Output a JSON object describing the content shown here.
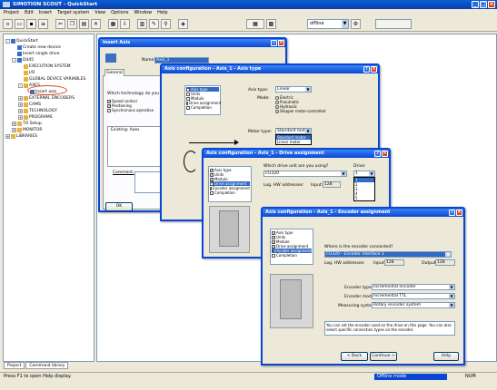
{
  "app": {
    "title": "SIMOTION SCOUT - QuickStart"
  },
  "menu": [
    "Project",
    "Edit",
    "Insert",
    "Target system",
    "View",
    "Options",
    "Window",
    "Help"
  ],
  "toolbar": {
    "mode_select": "offline",
    "mode_arrow": "▼"
  },
  "tree": {
    "items": [
      {
        "label": "QuickStart",
        "indent": 0,
        "expander": "-",
        "icon": "project"
      },
      {
        "label": "Create new device",
        "indent": 1,
        "expander": "",
        "icon": "device"
      },
      {
        "label": "Insert single drive",
        "indent": 1,
        "expander": "",
        "icon": "device"
      },
      {
        "label": "D445",
        "indent": 1,
        "expander": "-",
        "icon": "device"
      },
      {
        "label": "EXECUTION SYSTEM",
        "indent": 2,
        "expander": "",
        "icon": "folder"
      },
      {
        "label": "I/O",
        "indent": 2,
        "expander": "",
        "icon": "folder"
      },
      {
        "label": "GLOBAL DEVICE VARIABLES",
        "indent": 2,
        "expander": "",
        "icon": "folder"
      },
      {
        "label": "AXES",
        "indent": 2,
        "expander": "-",
        "icon": "folder"
      },
      {
        "label": "Insert axis",
        "indent": 3,
        "expander": "",
        "icon": "axis"
      },
      {
        "label": "EXTERNAL ENCODERS",
        "indent": 2,
        "expander": "+",
        "icon": "folder"
      },
      {
        "label": "CAMS",
        "indent": 2,
        "expander": "+",
        "icon": "folder"
      },
      {
        "label": "TECHNOLOGY",
        "indent": 2,
        "expander": "+",
        "icon": "folder"
      },
      {
        "label": "PROGRAMS",
        "indent": 2,
        "expander": "+",
        "icon": "folder"
      },
      {
        "label": "TO Setup",
        "indent": 1,
        "expander": "+",
        "icon": "folder"
      },
      {
        "label": "MONITOR",
        "indent": 1,
        "expander": "+",
        "icon": "folder"
      },
      {
        "label": "LIBRARIES",
        "indent": 0,
        "expander": "+",
        "icon": "folder"
      }
    ]
  },
  "tabs": [
    "Project",
    "Command library"
  ],
  "status": {
    "help": "Press F1 to open Help display.",
    "mode": "Offline mode",
    "num": "NUM"
  },
  "insert_axis": {
    "title": "Insert Axis",
    "name_label": "Name:",
    "name_value": "Axis_1",
    "tab": "General",
    "tech_q": "Which technology do you need?",
    "opt1": "Speed control",
    "opt2": "Positioning",
    "opt3": "Synchronous operation",
    "existing": "Existing: Axes",
    "comment": "Comment:",
    "ok": "OK"
  },
  "axis_type": {
    "title": "Axis configuration - Axis_1 - Axis type",
    "axis_type_label": "Axis type:",
    "axis_type_value": "Linear",
    "mode_label": "Mode:",
    "mode_opts": [
      "Electric",
      "Pneumatic",
      "Hydraulic",
      "Stepper motor-controlled"
    ],
    "motor_label": "Motor type:",
    "motor_value": "Standard motor",
    "motor_list": [
      "Standard motor",
      "Linear motor"
    ],
    "steps": [
      "Axis type",
      "Units",
      "Modulo",
      "Drive assignment",
      "Completion"
    ]
  },
  "drive_assign": {
    "title": "Axis configuration - Axis_1 - Drive assignment",
    "q": "Which drive unit are you using?",
    "drive_value": "CU320",
    "number_label": "Drive:",
    "number_value": "1",
    "number_list": [
      "1",
      "2",
      "3",
      "4",
      "5"
    ],
    "log_label": "Log. HW addresses:",
    "input_label": "Input:",
    "input_value": "128",
    "steps": [
      "Axis type",
      "Units",
      "Modulo",
      "Drive assignment",
      "Encoder assignment",
      "Completion"
    ]
  },
  "encoder": {
    "title": "Axis configuration - Axis_1 - Encoder assignment",
    "q": "Where is the encoder connected?",
    "enc_value": "CU320 - Encoder interface 1",
    "log_label": "Log. HW addresses:",
    "input_label": "Input:",
    "input_value": "128",
    "output_label": "Output:",
    "output_value": "128",
    "type_label": "Encoder type:",
    "type_value": "Incremental encoder",
    "mode_label": "Encoder mode:",
    "mode_value": "Incremental TTL",
    "sys_label": "Measuring system:",
    "sys_value": "Rotary encoder system",
    "note": "You can set the encoder used on the drive on this page. You can also select specific connection types on the encoder.",
    "back": "< Back",
    "cont": "Continue >",
    "help": "Help",
    "steps": [
      "Axis type",
      "Units",
      "Modulo",
      "Drive assignment",
      "Encoder assignment",
      "Completion"
    ]
  },
  "colors": {
    "title_blue": "#0a46d4",
    "accent": "#316ac5",
    "offline": "#0a46d4",
    "highlight_circle": "#d9451c"
  }
}
